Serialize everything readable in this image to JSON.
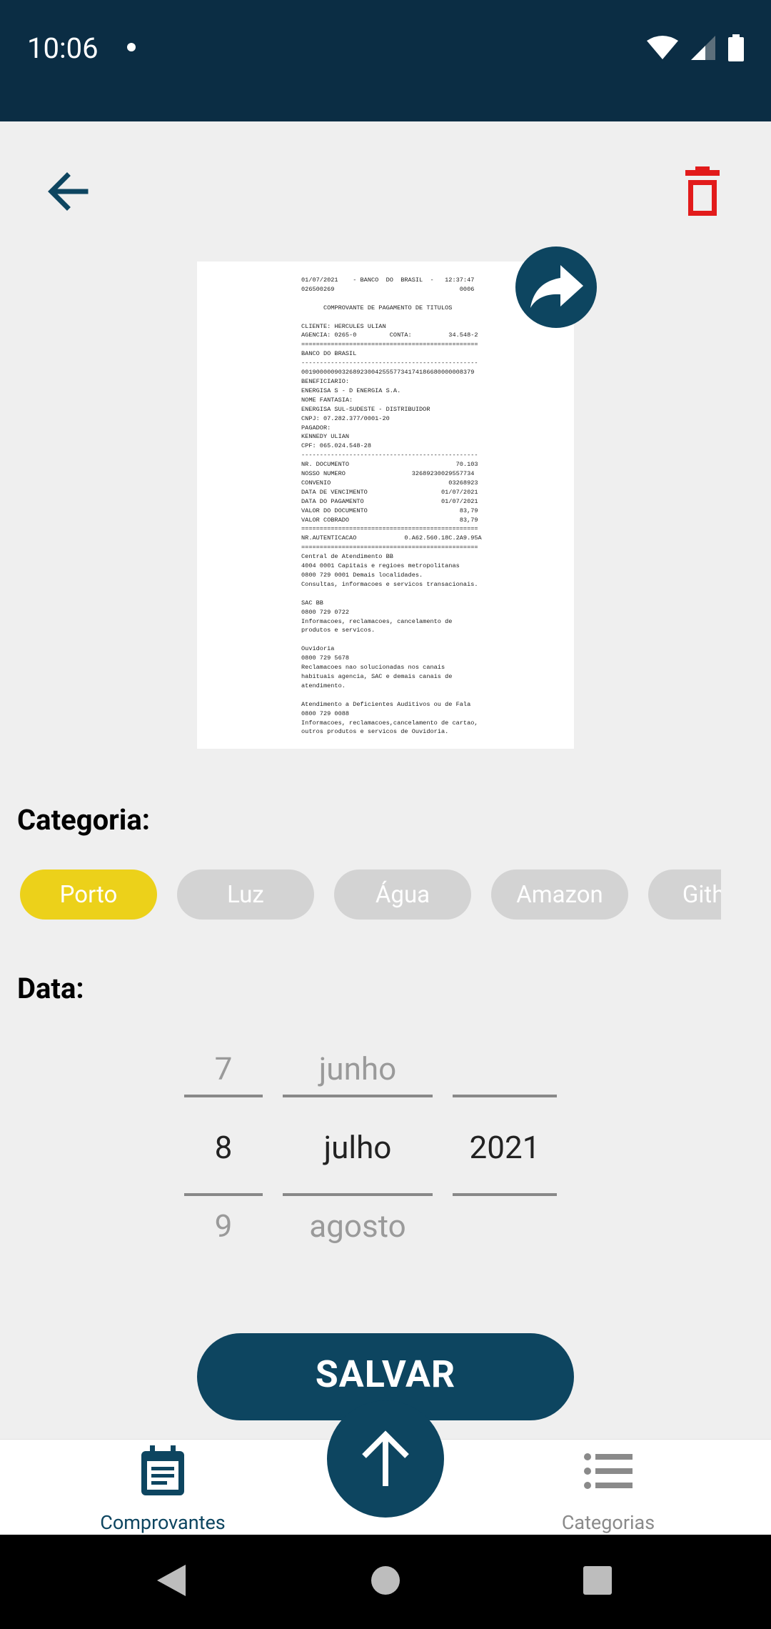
{
  "status": {
    "time": "10:06"
  },
  "receipt": {
    "lines": [
      "01/07/2021    - BANCO  DO  BRASIL  -   12:37:47",
      "026500269                                  0006",
      "",
      "      COMPROVANTE DE PAGAMENTO DE TITULOS",
      "",
      "CLIENTE: HERCULES ULIAN",
      "AGENCIA: 0265-0         CONTA:          34.548-2",
      "================================================",
      "BANCO DO BRASIL",
      "------------------------------------------------",
      "00190000090326892300425557734174186680000008379",
      "BENEFICIARIO:",
      "ENERGISA S - D ENERGIA S.A.",
      "NOME FANTASIA:",
      "ENERGISA SUL-SUDESTE - DISTRIBUIDOR",
      "CNPJ: 07.282.377/0001-20",
      "PAGADOR:",
      "KENNEDY ULIAN",
      "CPF: 065.024.548-28",
      "------------------------------------------------",
      "NR. DOCUMENTO                             70.103",
      "NOSSO NUMERO                  32689230029557734",
      "CONVENIO                                03268923",
      "DATA DE VENCIMENTO                    01/07/2021",
      "DATA DO PAGAMENTO                     01/07/2021",
      "VALOR DO DOCUMENTO                         83,79",
      "VALOR COBRADO                              83,79",
      "================================================",
      "NR.AUTENTICACAO             0.A62.560.18C.2A9.95A",
      "================================================",
      "Central de Atendimento BB",
      "4004 0001 Capitais e regioes metropolitanas",
      "0800 729 0001 Demais localidades.",
      "Consultas, informacoes e servicos transacionais.",
      "",
      "SAC BB",
      "0800 729 0722",
      "Informacoes, reclamacoes, cancelamento de",
      "produtos e servicos.",
      "",
      "Ouvidoria",
      "0800 729 5678",
      "Reclamacoes nao solucionadas nos canais",
      "habituais agencia, SAC e demais canais de",
      "atendimento.",
      "",
      "Atendimento a Deficientes Auditivos ou de Fala",
      "0800 729 0088",
      "Informacoes, reclamacoes,cancelamento de cartao,",
      "outros produtos e servicos de Ouvidoria."
    ]
  },
  "labels": {
    "category": "Categoria:",
    "date": "Data:"
  },
  "categories": [
    {
      "label": "Porto",
      "selected": true
    },
    {
      "label": "Luz",
      "selected": false
    },
    {
      "label": "Água",
      "selected": false
    },
    {
      "label": "Amazon",
      "selected": false
    },
    {
      "label": "Github",
      "selected": false
    }
  ],
  "date_picker": {
    "day": {
      "prev": "7",
      "selected": "8",
      "next": "9"
    },
    "month": {
      "prev": "junho",
      "selected": "julho",
      "next": "agosto"
    },
    "year": {
      "prev": "",
      "selected": "2021",
      "next": ""
    }
  },
  "save_label": "SALVAR",
  "bottom_nav": {
    "left_label": "Comprovantes",
    "right_label": "Categorias"
  },
  "colors": {
    "primary": "#0d4560",
    "status_bar": "#0b2d44",
    "selected_chip": "#ecd11a",
    "chip": "#d3d3d3",
    "delete": "#e21b1b",
    "inactive_nav": "#8a8a8a"
  },
  "icons": {
    "back": "arrow-left-icon",
    "delete": "trash-icon",
    "share": "share-arrow-icon",
    "upload": "arrow-up-icon",
    "receipts": "receipt-icon",
    "categories": "list-icon"
  }
}
